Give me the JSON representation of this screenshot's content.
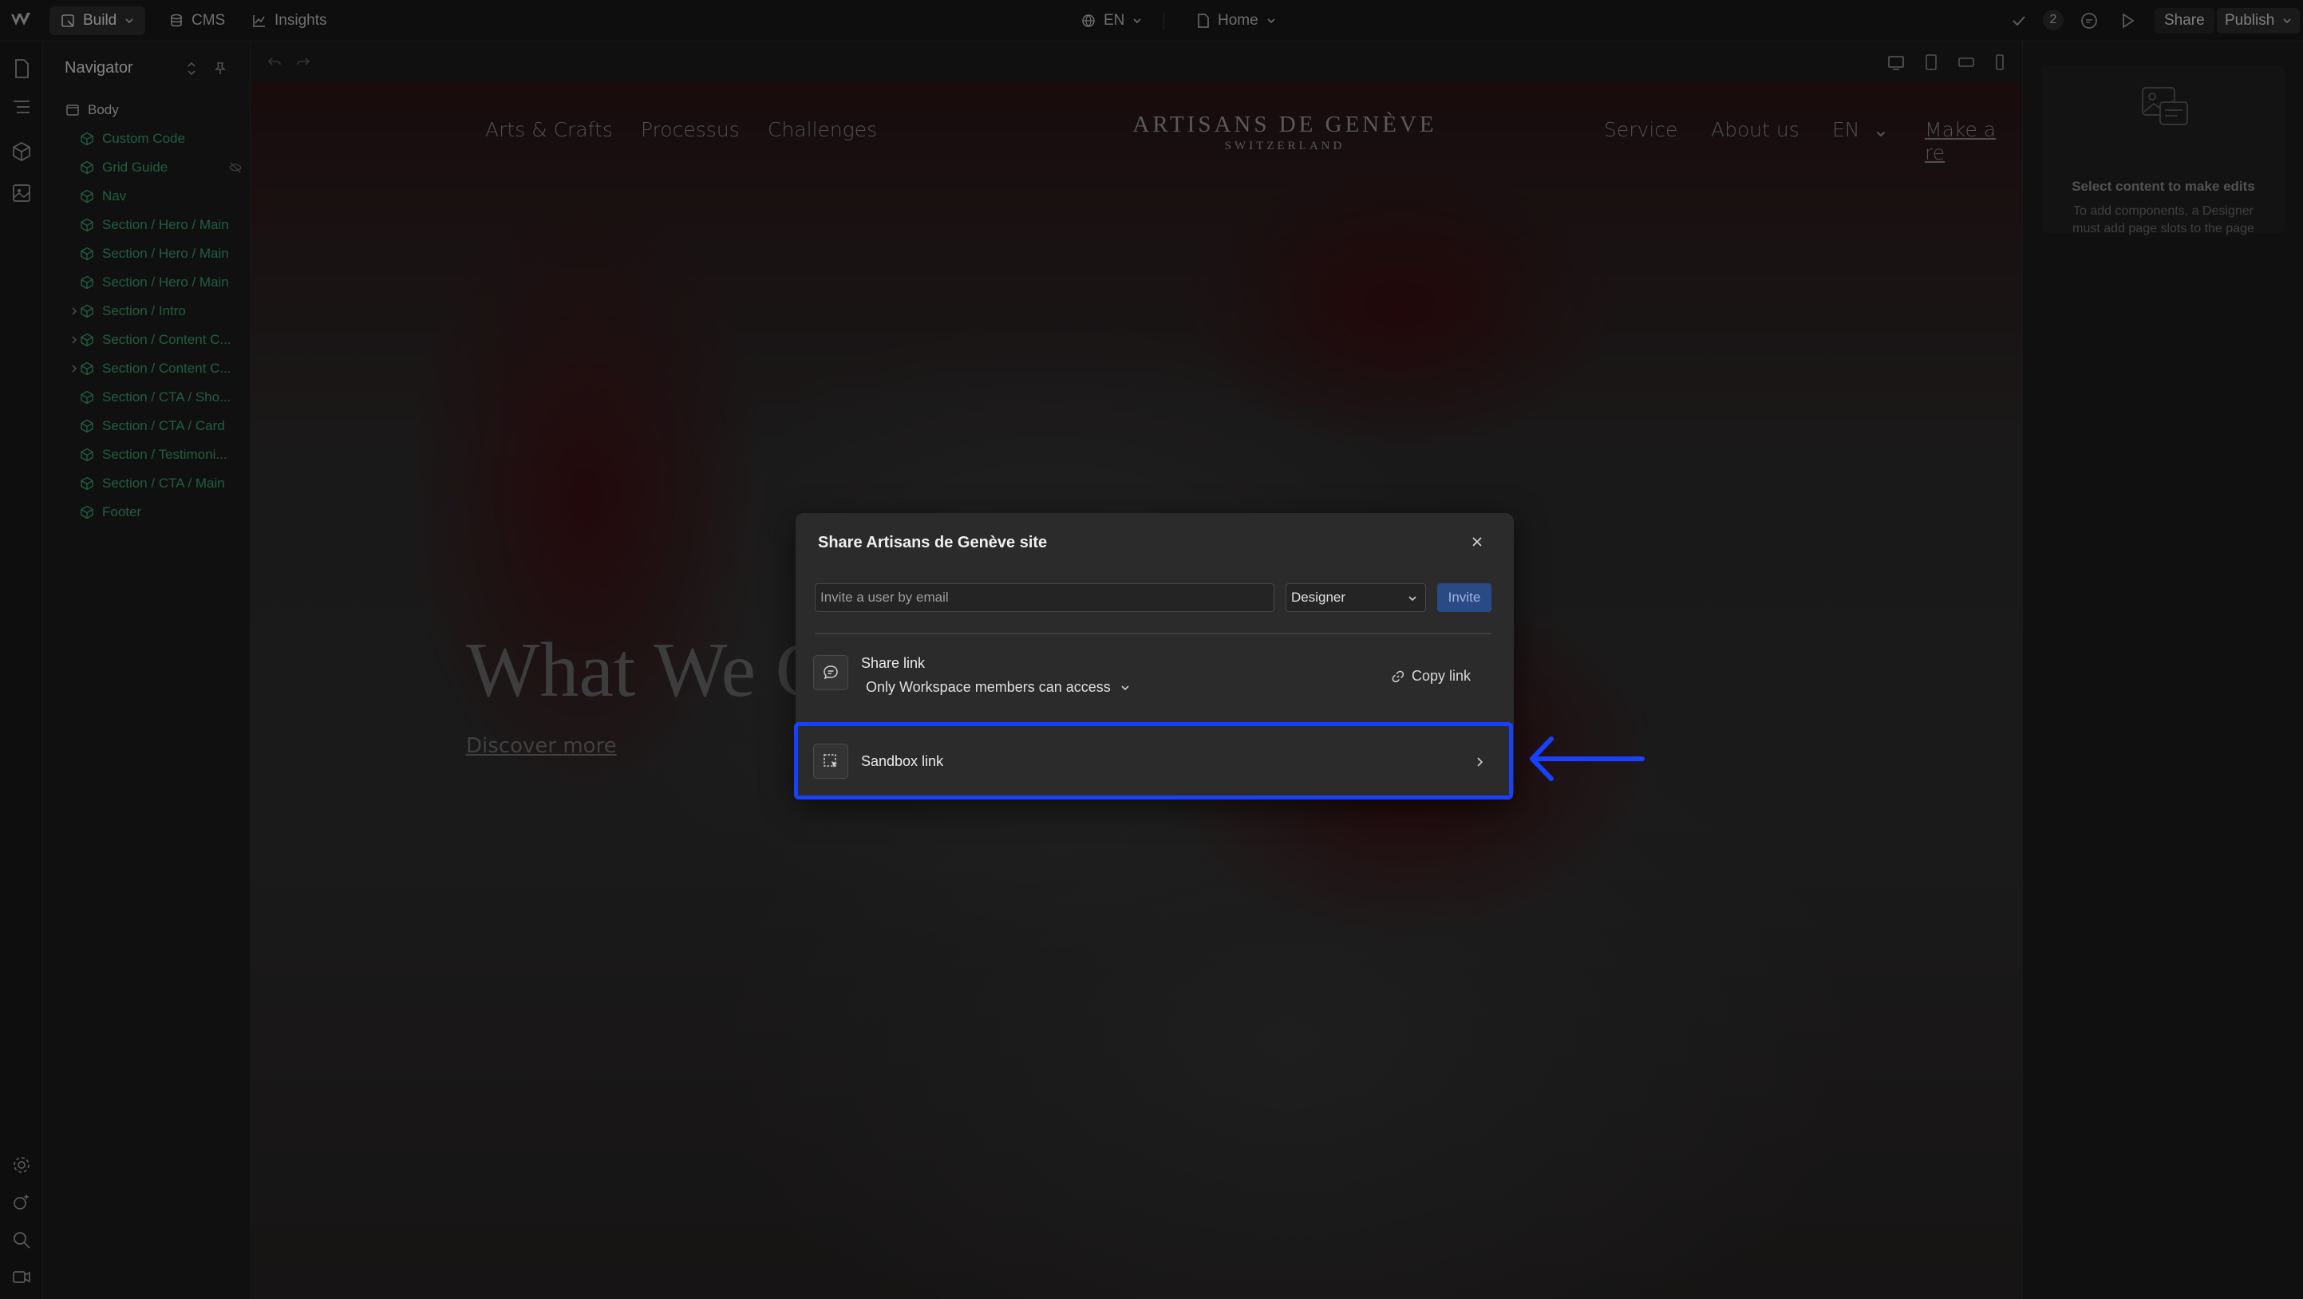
{
  "topbar": {
    "build_label": "Build",
    "cms_label": "CMS",
    "insights_label": "Insights",
    "locale": "EN",
    "page": "Home",
    "comments_count": "2",
    "share_label": "Share",
    "publish_label": "Publish"
  },
  "navigator": {
    "title": "Navigator",
    "items": [
      {
        "label": "Body"
      },
      {
        "label": "Custom Code"
      },
      {
        "label": "Grid Guide"
      },
      {
        "label": "Nav"
      },
      {
        "label": "Section / Hero / Main"
      },
      {
        "label": "Section / Hero / Main"
      },
      {
        "label": "Section / Hero / Main"
      },
      {
        "label": "Section / Intro"
      },
      {
        "label": "Section / Content C..."
      },
      {
        "label": "Section / Content C..."
      },
      {
        "label": "Section / CTA / Sho..."
      },
      {
        "label": "Section / CTA / Card"
      },
      {
        "label": "Section / Testimoni..."
      },
      {
        "label": "Section / CTA / Main"
      },
      {
        "label": "Footer"
      }
    ]
  },
  "site": {
    "nav_left": [
      "Arts & Crafts",
      "Processus",
      "Challenges"
    ],
    "brand": "ARTISANS DE GENÈVE",
    "brand_sub": "SWITZERLAND",
    "nav_right": [
      "Service",
      "About us",
      "EN"
    ],
    "cta": "Make a re",
    "hero_title": "What We C",
    "hero_link": "Discover more"
  },
  "right_panel": {
    "title": "Select content to make edits",
    "description": "To add components, a Designer must add page slots to the page"
  },
  "modal": {
    "title": "Share Artisans de Genève site",
    "invite_placeholder": "Invite a user by email",
    "role": "Designer",
    "invite_label": "Invite",
    "share_link_title": "Share link",
    "access": "Only Workspace members can access",
    "copy_link_label": "Copy link",
    "sandbox_label": "Sandbox link"
  },
  "colors": {
    "highlight": "#1740ff",
    "accent_green": "#3aa36b",
    "invite_button": "#2a4a86"
  }
}
